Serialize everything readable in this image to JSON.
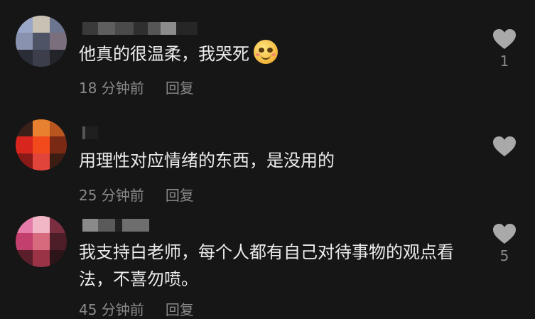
{
  "comments": [
    {
      "text": "他真的很温柔，我哭死",
      "emoji": "blushing-smile-emoji",
      "time": "18 分钟前",
      "reply": "回复",
      "likes": "1",
      "avatar_colors": [
        "#9aa7c8",
        "#c9c1b3",
        "#6b7590",
        "#8993b0",
        "#4e5466",
        "#7c6f7d",
        "#2a2d36",
        "#3c3f4b",
        "#23242a"
      ]
    },
    {
      "text": "用理性对应情绪的东西，是没用的",
      "time": "25 分钟前",
      "reply": "回复",
      "likes": "",
      "avatar_colors": [
        "#3a2018",
        "#e8812f",
        "#b9551e",
        "#d8261f",
        "#f24a1d",
        "#7a2a14",
        "#8a1a18",
        "#e0443b",
        "#3b1d13"
      ]
    },
    {
      "text": "我支持白老师，每个人都有自己对待事物的观点看法，不喜勿喷。",
      "time": "45 分钟前",
      "reply": "回复",
      "likes": "5",
      "avatar_colors": [
        "#e47ba8",
        "#f1b7c7",
        "#7a2e40",
        "#c33f6d",
        "#d86a7e",
        "#4d1d28",
        "#5a1f2b",
        "#9b3346",
        "#2c1418"
      ]
    }
  ],
  "colors": {
    "background": "#161616",
    "text": "#ececec",
    "muted": "#8a8a8a",
    "heart": "#a9a9a9"
  }
}
